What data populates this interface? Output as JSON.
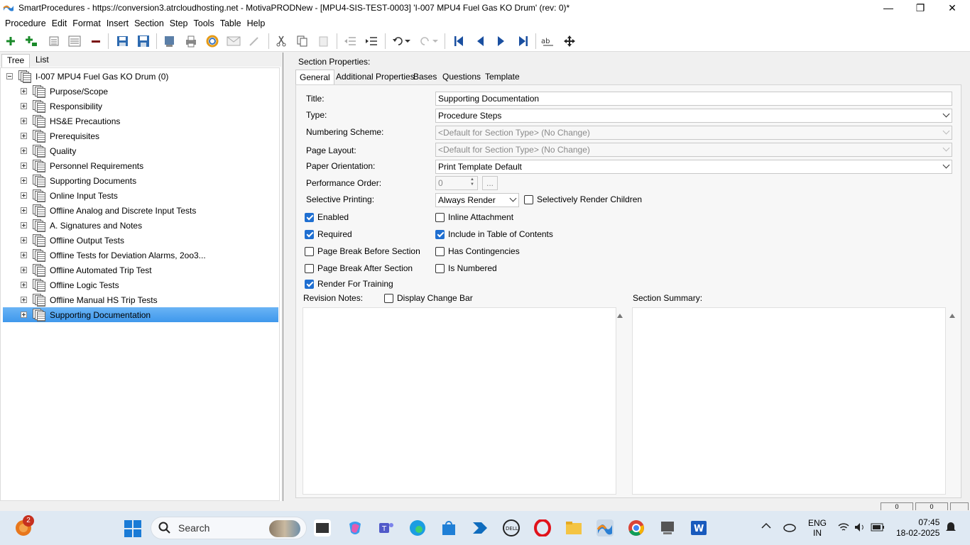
{
  "window": {
    "title": "SmartProcedures - https://conversion3.atrcloudhosting.net - MotivaPRODNew - [MPU4-SIS-TEST-0003] 'I-007 MPU4 Fuel Gas KO Drum' (rev: 0)*",
    "minimize": "—",
    "maximize": "❐",
    "close": "✕"
  },
  "menu": [
    "Procedure",
    "Edit",
    "Format",
    "Insert",
    "Section",
    "Step",
    "Tools",
    "Table",
    "Help"
  ],
  "left_tabs": [
    "Tree",
    "List"
  ],
  "tree": {
    "root": "I-007 MPU4 Fuel Gas KO Drum (0)",
    "items": [
      "Purpose/Scope",
      "Responsibility",
      "HS&E Precautions",
      "Prerequisites",
      "Quality",
      "Personnel Requirements",
      "Supporting Documents",
      "Online Input Tests",
      "Offline Analog and Discrete Input Tests",
      "A. Signatures and Notes",
      "Offline Output Tests",
      "Offline Tests for Deviation Alarms, 2oo3...",
      "Offline Automated Trip Test",
      "Offline Logic Tests",
      "Offline Manual HS Trip Tests",
      "Supporting Documentation"
    ],
    "selected_index": 15
  },
  "section_properties": {
    "heading": "Section Properties:",
    "tabs": [
      "General",
      "Additional Properties",
      "Bases",
      "Questions",
      "Template"
    ],
    "labels": {
      "title": "Title:",
      "type": "Type:",
      "numbering": "Numbering Scheme:",
      "layout": "Page Layout:",
      "orientation": "Paper Orientation:",
      "perf_order": "Performance Order:",
      "selective": "Selective Printing:",
      "revision_notes": "Revision Notes:",
      "section_summary": "Section Summary:"
    },
    "values": {
      "title": "Supporting Documentation",
      "type": "Procedure Steps",
      "numbering": "<Default for Section Type> (No Change)",
      "layout": "<Default for Section Type> (No Change)",
      "orientation": "Print Template Default",
      "perf_order": "0",
      "perf_btn": "...",
      "selective": "Always Render"
    },
    "checkboxes": {
      "selectively_render_children": {
        "label": "Selectively Render Children",
        "checked": false
      },
      "enabled": {
        "label": "Enabled",
        "checked": true
      },
      "inline_attachment": {
        "label": "Inline Attachment",
        "checked": false
      },
      "required": {
        "label": "Required",
        "checked": true
      },
      "include_toc": {
        "label": "Include in Table of Contents",
        "checked": true
      },
      "page_break_before": {
        "label": "Page Break Before Section",
        "checked": false
      },
      "has_contingencies": {
        "label": "Has Contingencies",
        "checked": false
      },
      "page_break_after": {
        "label": "Page Break After Section",
        "checked": false
      },
      "is_numbered": {
        "label": "Is Numbered",
        "checked": false
      },
      "render_training": {
        "label": "Render For Training",
        "checked": true
      },
      "display_change_bar": {
        "label": "Display Change Bar",
        "checked": false
      }
    }
  },
  "statusbar": {
    "cell1": "0",
    "cell2": "0"
  },
  "taskbar": {
    "search_placeholder": "Search",
    "notification_count": "2",
    "lang1": "ENG",
    "lang2": "IN",
    "time": "07:45",
    "date": "18-02-2025"
  },
  "colors": {
    "selection": "#3f98ec",
    "checkbox_on": "#1f6fd1",
    "taskbar": "#dfe9f3"
  }
}
